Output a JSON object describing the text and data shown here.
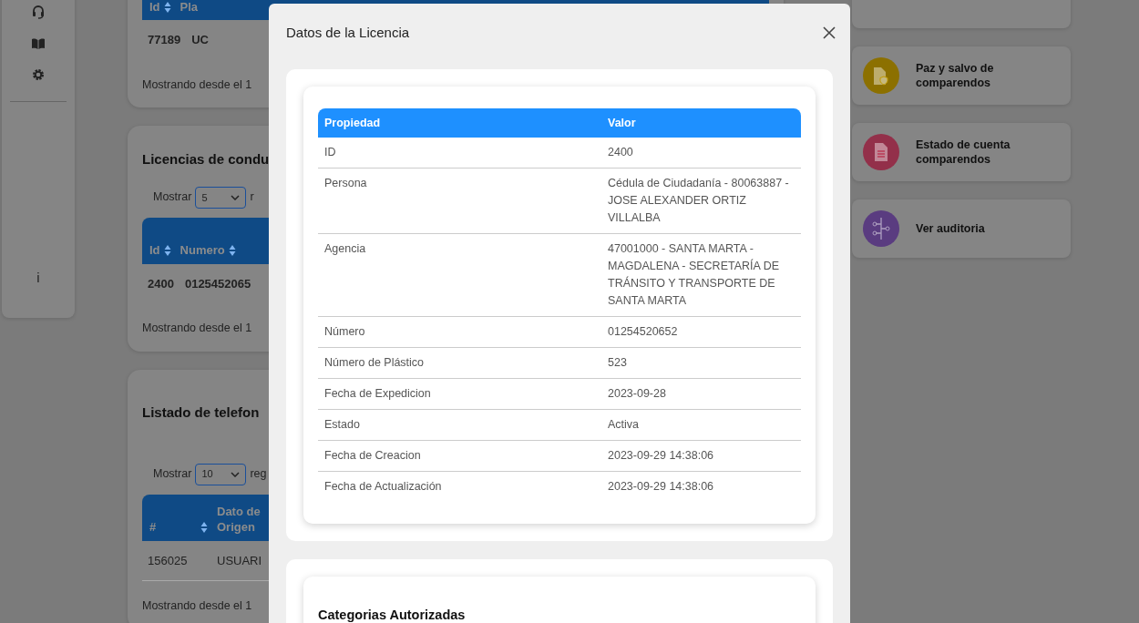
{
  "sidebar": {
    "info_label": "i"
  },
  "background_cards": [
    {
      "columns": [
        "Id",
        "Pla"
      ],
      "rows": [
        [
          "77189",
          "UC"
        ]
      ],
      "row_bold": true,
      "footer": "Mostrando desde el 1"
    },
    {
      "title": "Licencias de condu",
      "show_label": "Mostrar",
      "show_value": "5",
      "show_after": "r",
      "columns": [
        "Id",
        "Numero"
      ],
      "rows": [
        [
          "2400",
          "0125452065"
        ]
      ],
      "row_bold": true,
      "footer": "Mostrando desde el 1"
    },
    {
      "title": "Listado de telefon",
      "show_label": "Mostrar",
      "show_value": "10",
      "show_after": "reg",
      "columns": [
        "#",
        "Dato de Origen"
      ],
      "rows": [
        [
          "156025",
          "USUARI"
        ]
      ],
      "row_bold": false,
      "footer": "Mostrando desde el 1"
    }
  ],
  "actions": [
    {
      "label": "Paz y salvo de comparendos",
      "color": "#8c7000",
      "kind": "shield-doc"
    },
    {
      "label": "Estado de cuenta comparendos",
      "color": "#93304a",
      "kind": "doc"
    },
    {
      "label": "Ver auditoria",
      "color": "#5a3c80",
      "kind": "tree"
    }
  ],
  "modal": {
    "title": "Datos de la Licencia",
    "table": {
      "columns": [
        "Propiedad",
        "Valor"
      ],
      "rows": [
        {
          "property": "ID",
          "value": "2400"
        },
        {
          "property": "Persona",
          "value": "Cédula de Ciudadanía - 80063887 - JOSE ALEXANDER ORTIZ VILLALBA"
        },
        {
          "property": "Agencia",
          "value": "47001000 - SANTA MARTA - MAGDALENA - SECRETARÍA DE TRÁNSITO Y TRANSPORTE DE SANTA MARTA"
        },
        {
          "property": "Número",
          "value": "01254520652"
        },
        {
          "property": "Número de Plástico",
          "value": "523"
        },
        {
          "property": "Fecha de Expedicion",
          "value": "2023-09-28"
        },
        {
          "property": "Estado",
          "value": "Activa"
        },
        {
          "property": "Fecha de Creacion",
          "value": "2023-09-29 14:38:06"
        },
        {
          "property": "Fecha de Actualización",
          "value": "2023-09-29 14:38:06"
        }
      ]
    },
    "section_title": "Categorias Autorizadas"
  }
}
